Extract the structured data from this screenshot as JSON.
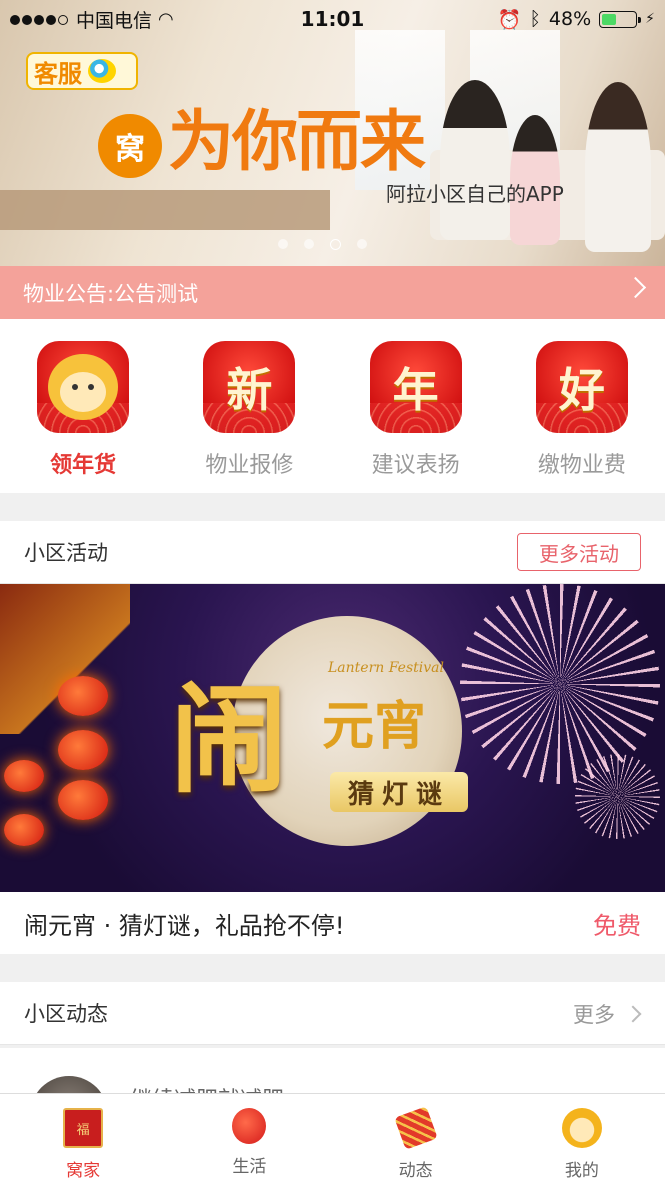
{
  "status_bar": {
    "carrier": "中国电信",
    "time": "11:01",
    "battery_percent": "48%",
    "battery_level": 0.48
  },
  "banner": {
    "kefu_label": "客服",
    "badge_text": "窝",
    "slogan": "为你而来",
    "sub_slogan": "阿拉小区自己的APP",
    "pager_count": 4,
    "pager_active_index": 2
  },
  "notice": {
    "text": "物业公告:公告测试"
  },
  "quick_actions": [
    {
      "label": "领年货",
      "icon": "monkey-icon",
      "active": true
    },
    {
      "label": "物业报修",
      "icon": "xin-icon",
      "glyph": "新"
    },
    {
      "label": "建议表扬",
      "icon": "nian-icon",
      "glyph": "年"
    },
    {
      "label": "缴物业费",
      "icon": "hao-icon",
      "glyph": "好"
    }
  ],
  "activities": {
    "title": "小区活动",
    "more_label": "更多活动",
    "event": {
      "image_title_big": "闹",
      "image_title_sub": "元宵",
      "image_tagline": "Lantern Festival",
      "image_riddle": "猜灯谜",
      "caption": "闹元宵 · 猜灯谜，礼品抢不停!",
      "price": "免费"
    }
  },
  "news": {
    "title": "小区动态",
    "more_label": "更多",
    "first_item_text": "继续减肥就减肥"
  },
  "tabbar": [
    {
      "label": "窝家",
      "icon": "fu-envelope-icon",
      "active": true
    },
    {
      "label": "生活",
      "icon": "lantern-icon"
    },
    {
      "label": "动态",
      "icon": "firecracker-icon"
    },
    {
      "label": "我的",
      "icon": "monkey-face-icon"
    }
  ],
  "colors": {
    "accent_red": "#e53935",
    "notice_bg": "#f4a29a",
    "more_button": "#e8636b"
  }
}
